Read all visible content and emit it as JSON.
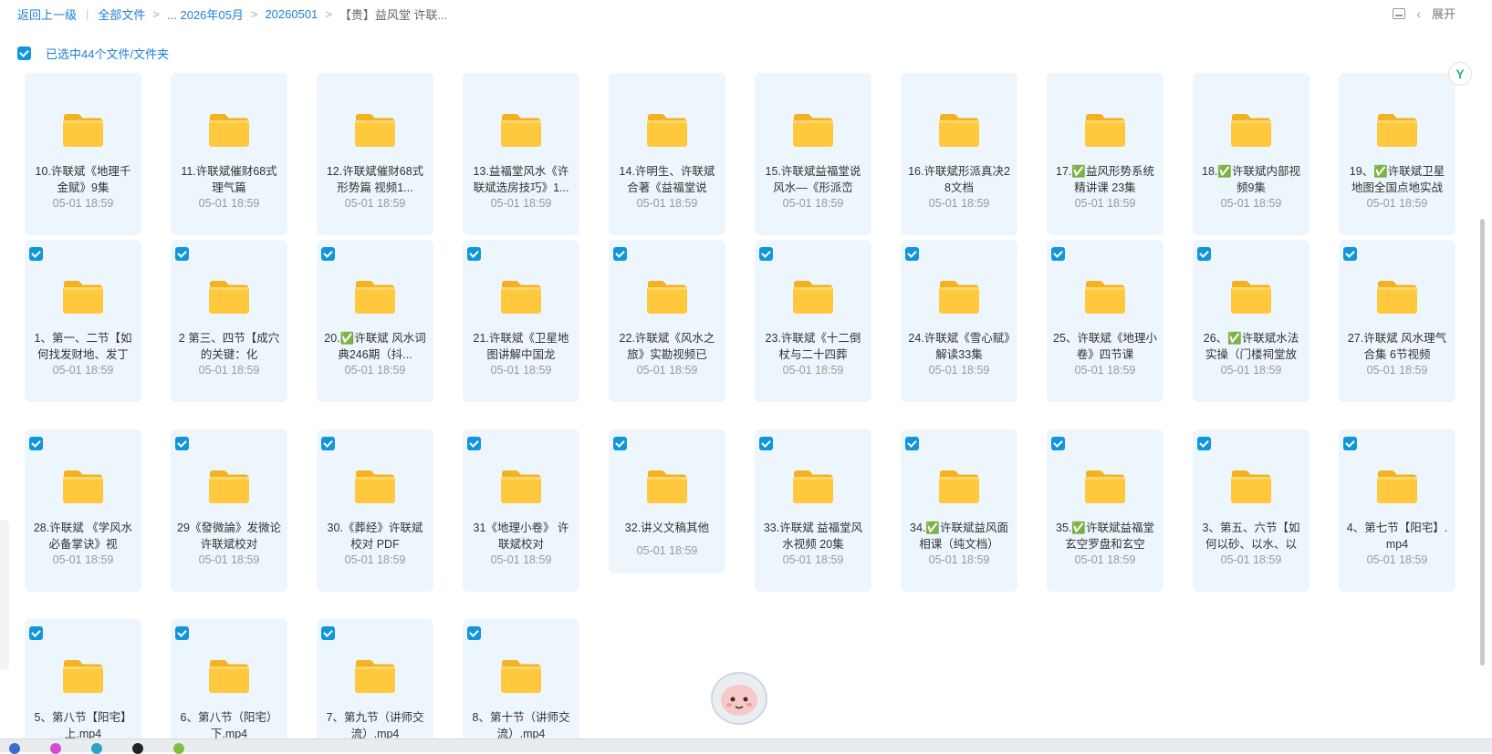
{
  "breadcrumb": {
    "back": "返回上一级",
    "all_files": "全部文件",
    "month": "... 2026年05月",
    "date": "20260501",
    "current": "【贵】益风堂 许联..."
  },
  "topright": {
    "expand_label": "展开"
  },
  "selection": {
    "text": "已选中44个文件/文件夹"
  },
  "folders": [
    {
      "name": "10.许联斌《地理千金赋》9集",
      "date": "05-01 18:59"
    },
    {
      "name": "11.许联斌催财68式理气篇",
      "date": "05-01 18:59"
    },
    {
      "name": "12.许联斌催财68式形势篇 视频1...",
      "date": "05-01 18:59"
    },
    {
      "name": "13.益福堂风水《许联斌选房技巧》1...",
      "date": "05-01 18:59"
    },
    {
      "name": "14.许明生、许联斌合著《益福堂说",
      "date": "05-01 18:59"
    },
    {
      "name": "15.许联斌益福堂说风水—《形派峦",
      "date": "05-01 18:59"
    },
    {
      "name": "16.许联斌形派真决28文档",
      "date": "05-01 18:59"
    },
    {
      "name": "17.✅益风形势系统精讲课 23集",
      "date": "05-01 18:59"
    },
    {
      "name": "18.✅许联斌内部视频9集",
      "date": "05-01 18:59"
    },
    {
      "name": "19、✅许联斌卫星地图全国点地实战",
      "date": "05-01 18:59"
    },
    {
      "name": "1、第一、二节【如何找发财地、发丁",
      "date": "05-01 18:59"
    },
    {
      "name": "2 第三、四节【成穴的关键：化",
      "date": "05-01 18:59"
    },
    {
      "name": "20.✅许联斌 风水词典246期（抖...",
      "date": "05-01 18:59"
    },
    {
      "name": "21.许联斌《卫星地图讲解中国龙",
      "date": "05-01 18:59"
    },
    {
      "name": "22.许联斌《风水之旅》实勘视频已",
      "date": "05-01 18:59"
    },
    {
      "name": "23.许联斌《十二倒杖与二十四葬",
      "date": "05-01 18:59"
    },
    {
      "name": "24.许联斌《雪心赋》解读33集",
      "date": "05-01 18:59"
    },
    {
      "name": "25、许联斌《地理小卷》四节课",
      "date": "05-01 18:59"
    },
    {
      "name": "26、✅许联斌水法实操（门楼祠堂放",
      "date": "05-01 18:59"
    },
    {
      "name": "27.许联斌 风水理气合集 6节视频",
      "date": "05-01 18:59"
    },
    {
      "name": "28.许联斌 《学风水必备掌诀》视",
      "date": "05-01 18:59"
    },
    {
      "name": "29《發微論》发微论 许联斌校对",
      "date": "05-01 18:59"
    },
    {
      "name": "30.《葬经》许联斌校对 PDF",
      "date": "05-01 18:59"
    },
    {
      "name": "31《地理小卷》 许联斌校对",
      "date": "05-01 18:59"
    },
    {
      "name": "32.讲义文稿其他",
      "date": "05-01 18:59"
    },
    {
      "name": "33.许联斌 益福堂风水视频 20集",
      "date": "05-01 18:59"
    },
    {
      "name": "34.✅许联斌益风面相课（纯文档）",
      "date": "05-01 18:59"
    },
    {
      "name": "35.✅许联斌益福堂玄空罗盘和玄空",
      "date": "05-01 18:59"
    },
    {
      "name": "3、第五、六节【如何以砂、以水、以",
      "date": "05-01 18:59"
    },
    {
      "name": "4、第七节【阳宅】.mp4",
      "date": "05-01 18:59"
    },
    {
      "name": "5、第八节【阳宅】上.mp4",
      "date": ""
    },
    {
      "name": "6、第八节（阳宅）下.mp4",
      "date": ""
    },
    {
      "name": "7、第九节（讲师交流）.mp4",
      "date": ""
    },
    {
      "name": "8、第十节（讲师交流）.mp4",
      "date": ""
    }
  ],
  "colors": {
    "accent": "#1296db",
    "link": "#1f7fd6",
    "card_bg": "#eef6fd",
    "folder": "#ffc83d"
  },
  "icons": {
    "side_badge": "Y"
  }
}
